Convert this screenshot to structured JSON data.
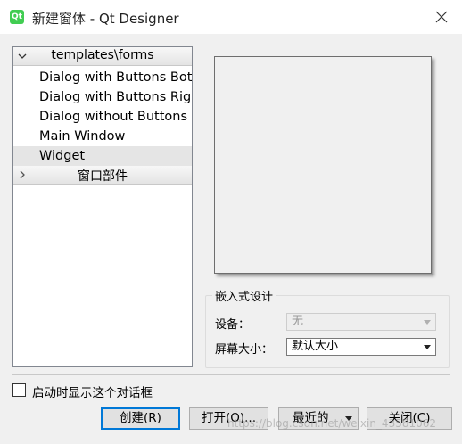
{
  "window": {
    "title": "新建窗体 - Qt Designer",
    "app_icon_text": "Qt"
  },
  "tree": {
    "categories": [
      {
        "label": "templates\\forms",
        "expanded": true
      },
      {
        "label": "窗口部件",
        "expanded": false
      }
    ],
    "items": [
      {
        "label": "Dialog with Buttons Bottom"
      },
      {
        "label": "Dialog with Buttons Right"
      },
      {
        "label": "Dialog without Buttons"
      },
      {
        "label": "Main Window"
      },
      {
        "label": "Widget",
        "selected": true
      }
    ]
  },
  "embedded": {
    "title": "嵌入式设计",
    "device_label": "设备：",
    "device_value": "无",
    "screen_size_label": "屏幕大小：",
    "screen_size_value": "默认大小"
  },
  "startup_checkbox": {
    "label": "启动时显示这个对话框",
    "checked": false
  },
  "buttons": {
    "create": "创建(R)",
    "open": "打开(O)...",
    "recent": "最近的",
    "close": "关闭(C)"
  },
  "watermark": "https://blog.csdn.net/weixin_43581062"
}
